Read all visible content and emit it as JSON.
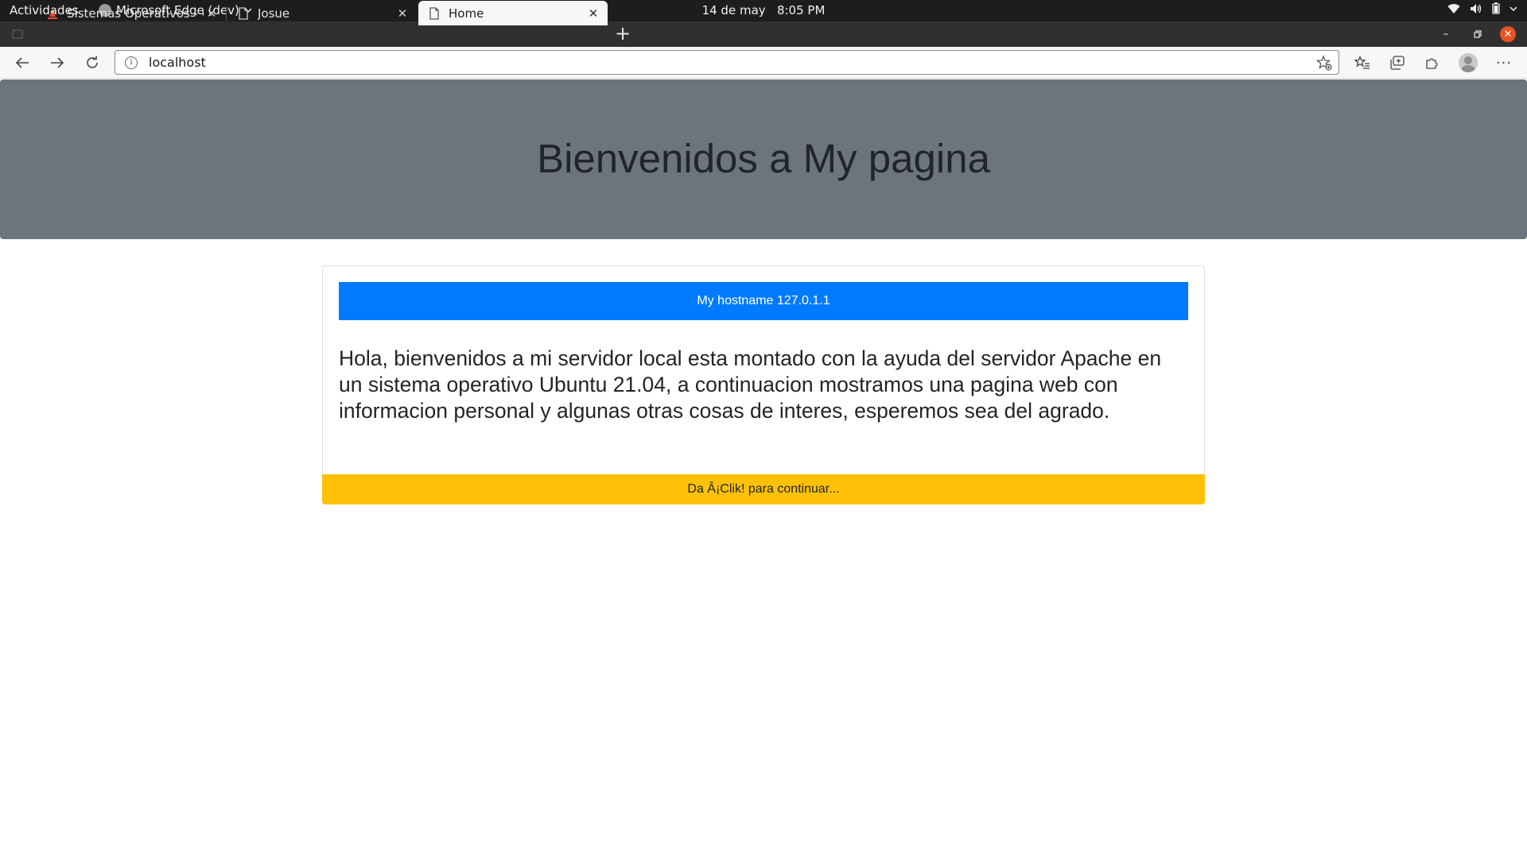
{
  "system_bar": {
    "activities": "Actividades",
    "app_name": "Microsoft Edge (dev)",
    "date": "14 de may",
    "time": "8:05 PM"
  },
  "tabs": [
    {
      "title": "Sistemas Operativos - Gru",
      "icon": "course-site-icon",
      "active": false
    },
    {
      "title": "Josue",
      "icon": "page-icon",
      "active": false
    },
    {
      "title": "Home",
      "icon": "page-icon",
      "active": true
    }
  ],
  "address_bar": {
    "url": "localhost"
  },
  "page": {
    "heading": "Bienvenidos a My pagina",
    "hostname_button": "My hostname 127.0.1.1",
    "body_text": "Hola, bienvenidos a mi servidor local esta montado con la ayuda del servidor Apache en un sistema operativo Ubuntu 21.04, a continuacion mostramos una pagina web con informacion personal y algunas otras cosas de interes, esperemos sea del agrado.",
    "footer_link": "Da Â¡Clik! para continuar..."
  },
  "colors": {
    "jumbotron": "#6c757d",
    "primary_button": "#007bff",
    "footer": "#ffc107",
    "close_button": "#e95420"
  }
}
